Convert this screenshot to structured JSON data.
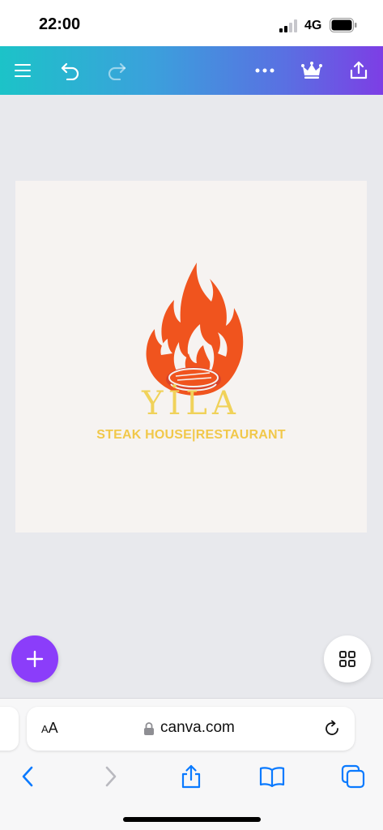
{
  "status_bar": {
    "time": "22:00",
    "network": "4G",
    "icons": [
      "signal-icon",
      "battery-icon"
    ]
  },
  "toolbar": {
    "icons": [
      "menu-icon",
      "undo-icon",
      "redo-icon",
      "more-icon",
      "crown-icon",
      "share-icon"
    ],
    "gradient": [
      "#1cc3c8",
      "#7d3ee5"
    ]
  },
  "design": {
    "brand_name": "YİLA",
    "tagline": "STEAK HOUSE|RESTAURANT",
    "logo": "flame-steak-icon",
    "colors": {
      "flame": "#f0541e",
      "text": "#f1c84a",
      "background": "#f6f3f1"
    }
  },
  "floating": {
    "add_icon": "plus-icon",
    "pages_icon": "grid-icon",
    "add_color": "#8b3dfa"
  },
  "safari": {
    "text_size_label_small": "A",
    "text_size_label_large": "A",
    "url": "canva.com",
    "icons": [
      "lock-icon",
      "reload-icon",
      "back-icon",
      "forward-icon",
      "share-icon",
      "bookmarks-icon",
      "tabs-icon"
    ],
    "accent": "#0a7aff"
  }
}
